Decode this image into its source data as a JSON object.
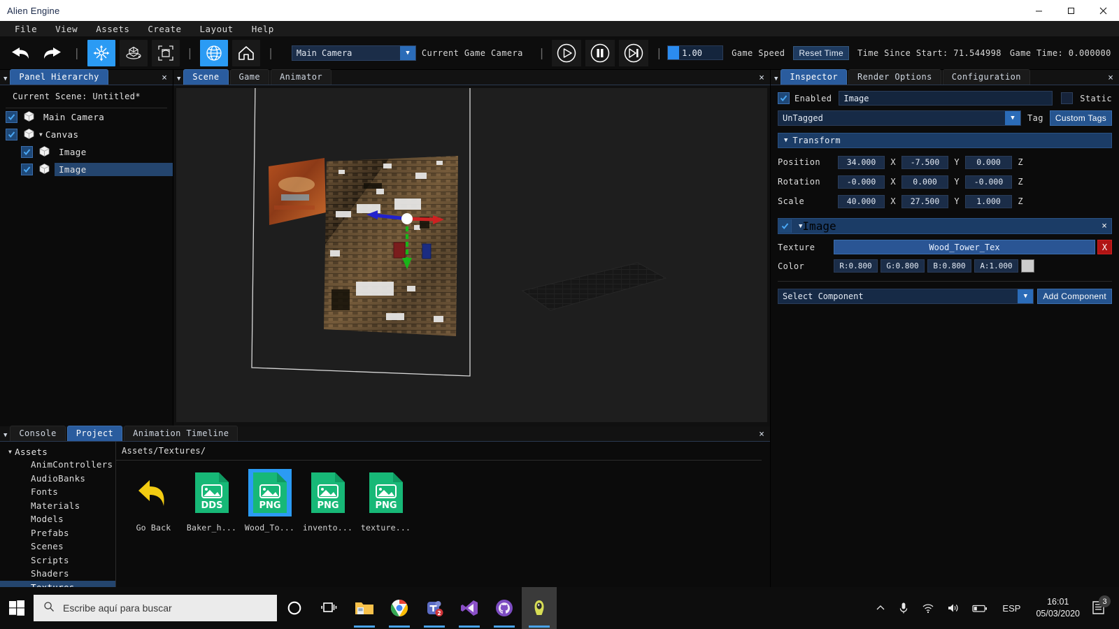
{
  "window": {
    "title": "Alien Engine",
    "minimize_label": "minimize",
    "maximize_label": "maximize",
    "close_label": "close"
  },
  "menubar": {
    "items": [
      {
        "label": "File"
      },
      {
        "label": "View"
      },
      {
        "label": "Assets"
      },
      {
        "label": "Create"
      },
      {
        "label": "Layout"
      },
      {
        "label": "Help"
      }
    ]
  },
  "toolbar": {
    "undo_icon": "undo-arrow-icon",
    "redo_icon": "redo-arrow-icon",
    "translate_icon": "translate-gizmo-icon",
    "rotate_icon": "rotate-gizmo-icon",
    "scale_icon": "scale-gizmo-icon",
    "global_icon": "globe-icon",
    "home_icon": "home-icon",
    "camera_value": "Main Camera",
    "camera_label": "Current Game Camera",
    "play_icon": "play-icon",
    "pause_icon": "pause-icon",
    "step_icon": "step-forward-icon",
    "speed_value": "1.00",
    "speed_label": "Game Speed",
    "reset_time_label": "Reset Time",
    "time_since_start": "Time Since Start: 71.544998",
    "game_time": "Game Time: 0.000000",
    "separator": "|"
  },
  "hierarchy": {
    "tab_label": "Panel Hierarchy",
    "close_label": "×",
    "scene_label": "Current Scene: Untitled*",
    "items": [
      {
        "label": "Main Camera",
        "checked": true,
        "depth": 0,
        "expandable": false,
        "selected": false
      },
      {
        "label": "Canvas",
        "checked": true,
        "depth": 0,
        "expandable": true,
        "selected": false
      },
      {
        "label": "Image",
        "checked": true,
        "depth": 1,
        "expandable": false,
        "selected": false
      },
      {
        "label": "Image",
        "checked": true,
        "depth": 1,
        "expandable": false,
        "selected": true
      }
    ]
  },
  "scene": {
    "tabs": [
      {
        "label": "Scene",
        "active": true
      },
      {
        "label": "Game",
        "active": false
      },
      {
        "label": "Animator",
        "active": false
      }
    ],
    "close_label": "×",
    "gizmo": {
      "x_axis_color": "#d42a2a",
      "y_axis_color": "#19b519",
      "z_axis_color": "#2a2ad4",
      "center_color": "#ffffff"
    }
  },
  "inspector": {
    "tabs": [
      {
        "label": "Inspector",
        "active": true
      },
      {
        "label": "Render Options",
        "active": false
      },
      {
        "label": "Configuration",
        "active": false
      }
    ],
    "close_label": "×",
    "enabled_label": "Enabled",
    "enabled_checked": true,
    "object_name": "Image",
    "static_label": "Static",
    "static_checked": false,
    "tag_value": "UnTagged",
    "tag_label": "Tag",
    "custom_tags_label": "Custom Tags",
    "transform": {
      "title": "Transform",
      "rows": [
        {
          "label": "Position",
          "x": "34.000",
          "y": "-7.500",
          "z": "0.000"
        },
        {
          "label": "Rotation",
          "x": "-0.000",
          "y": "0.000",
          "z": "-0.000"
        },
        {
          "label": "Scale",
          "x": "40.000",
          "y": "27.500",
          "z": "1.000"
        }
      ],
      "axis_x": "X",
      "axis_y": "Y",
      "axis_z": "Z"
    },
    "image_component": {
      "title": "Image",
      "enabled_checked": true,
      "remove_label": "×",
      "texture_label": "Texture",
      "texture_value": "Wood_Tower_Tex",
      "texture_clear_label": "X",
      "color_label": "Color",
      "color_r": "R:0.800",
      "color_g": "G:0.800",
      "color_b": "B:0.800",
      "color_a": "A:1.000",
      "swatch_hex": "#cccccc"
    },
    "select_component_value": "Select Component",
    "add_component_label": "Add Component"
  },
  "project": {
    "tabs": [
      {
        "label": "Console",
        "active": false
      },
      {
        "label": "Project",
        "active": true
      },
      {
        "label": "Animation Timeline",
        "active": false
      }
    ],
    "close_label": "×",
    "tree_root": "Assets",
    "tree_items": [
      {
        "label": "AnimControllers",
        "selected": false
      },
      {
        "label": "AudioBanks",
        "selected": false
      },
      {
        "label": "Fonts",
        "selected": false
      },
      {
        "label": "Materials",
        "selected": false
      },
      {
        "label": "Models",
        "selected": false
      },
      {
        "label": "Prefabs",
        "selected": false
      },
      {
        "label": "Scenes",
        "selected": false
      },
      {
        "label": "Scripts",
        "selected": false
      },
      {
        "label": "Shaders",
        "selected": false
      },
      {
        "label": "Textures",
        "selected": true
      }
    ],
    "path": "Assets/Textures/",
    "assets": [
      {
        "label": "Go Back",
        "kind": "back",
        "badge": "",
        "selected": false
      },
      {
        "label": "Baker_h...",
        "kind": "file",
        "badge": "DDS",
        "selected": false
      },
      {
        "label": "Wood_To...",
        "kind": "file",
        "badge": "PNG",
        "selected": true
      },
      {
        "label": "invento...",
        "kind": "file",
        "badge": "PNG",
        "selected": false
      },
      {
        "label": "texture...",
        "kind": "file",
        "badge": "PNG",
        "selected": false
      }
    ]
  },
  "taskbar": {
    "start_icon": "windows-start-icon",
    "search_placeholder": "Escribe aquí para buscar",
    "search_icon": "search-icon",
    "apps": [
      {
        "name": "cortana-icon",
        "running": false,
        "focused": false
      },
      {
        "name": "task-view-icon",
        "running": false,
        "focused": false
      },
      {
        "name": "file-explorer-icon",
        "running": true,
        "focused": false
      },
      {
        "name": "google-chrome-icon",
        "running": true,
        "focused": false,
        "badge": ""
      },
      {
        "name": "microsoft-teams-icon",
        "running": true,
        "focused": false,
        "badge": "2"
      },
      {
        "name": "visual-studio-icon",
        "running": true,
        "focused": false
      },
      {
        "name": "github-desktop-icon",
        "running": true,
        "focused": false
      },
      {
        "name": "alien-engine-icon",
        "running": true,
        "focused": true
      }
    ],
    "tray": {
      "chevron_icon": "chevron-up-icon",
      "microphone_icon": "microphone-icon",
      "wifi_icon": "wifi-icon",
      "volume_icon": "volume-icon",
      "battery_icon": "battery-icon",
      "language": "ESP",
      "time": "16:01",
      "date": "05/03/2020",
      "notification_icon": "notification-icon",
      "notification_count": "3"
    }
  }
}
